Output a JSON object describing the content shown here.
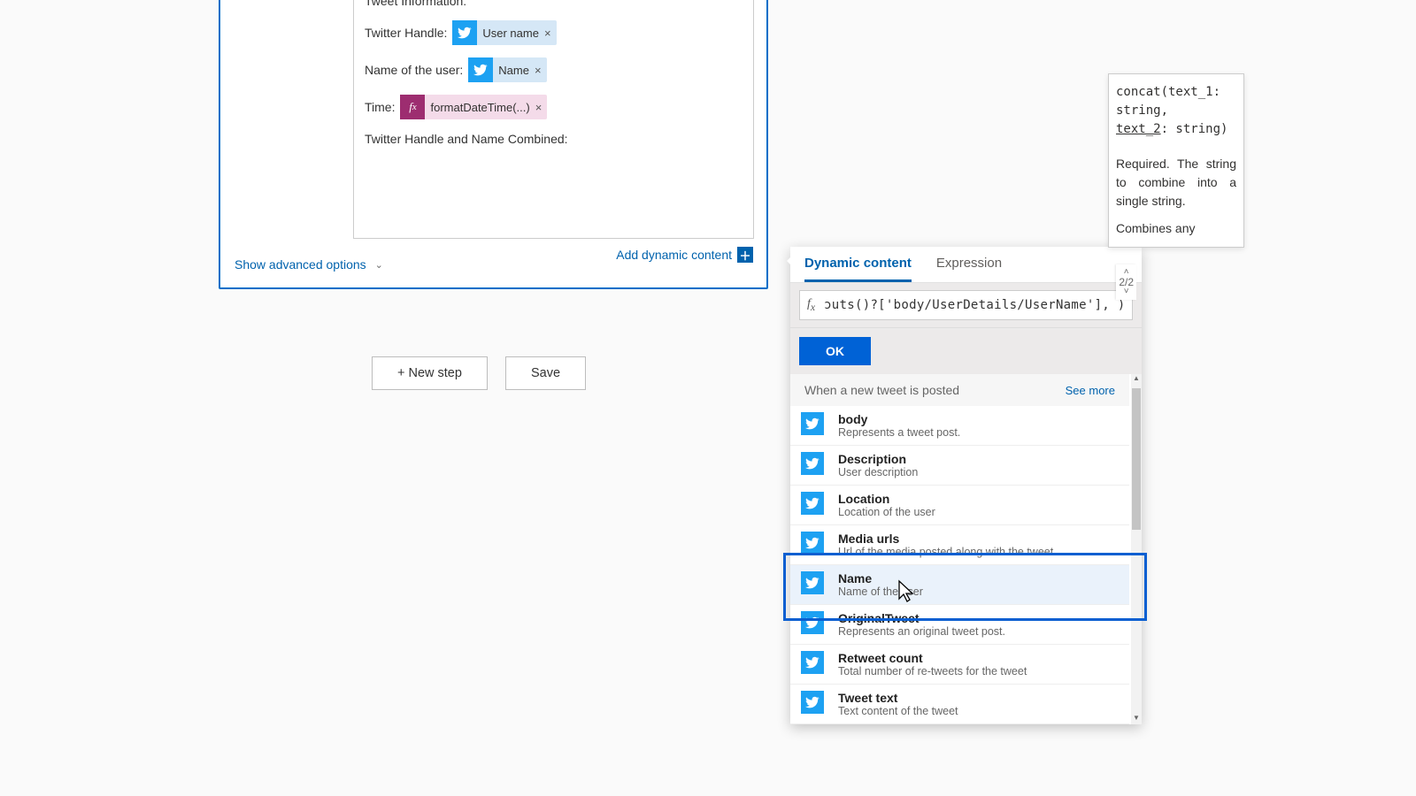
{
  "card": {
    "header_line": "Tweet Information:",
    "rows": {
      "handle_label": "Twitter Handle:",
      "handle_token": "User name",
      "name_label": "Name of the user:",
      "name_token": "Name",
      "time_label": "Time:",
      "time_token": "formatDateTime(...)",
      "combined_label": "Twitter Handle and Name Combined:"
    },
    "add_dynamic": "Add dynamic content",
    "show_advanced": "Show advanced options"
  },
  "buttons": {
    "new_step": "+ New step",
    "save": "Save"
  },
  "picker": {
    "tab_dynamic": "Dynamic content",
    "tab_expression": "Expression",
    "counter": "2/2",
    "expression_text": "ɔuts()?['body/UserDetails/UserName'], )",
    "ok": "OK",
    "group_title": "When a new tweet is posted",
    "see_more": "See more",
    "items": [
      {
        "title": "body",
        "desc": "Represents a tweet post."
      },
      {
        "title": "Description",
        "desc": "User description"
      },
      {
        "title": "Location",
        "desc": "Location of the user"
      },
      {
        "title": "Media urls",
        "desc": "Url of the media posted along with the tweet"
      },
      {
        "title": "Name",
        "desc": "Name of the user"
      },
      {
        "title": "OriginalTweet",
        "desc": "Represents an original tweet post."
      },
      {
        "title": "Retweet count",
        "desc": "Total number of re-tweets for the tweet"
      },
      {
        "title": "Tweet text",
        "desc": "Text content of the tweet"
      }
    ]
  },
  "tooltip": {
    "sig1": "concat(text_1: string,",
    "sig2_underlined": "text_2",
    "sig3": ": string)",
    "req": "Required. The string to combine into a single string.",
    "cut": "Combines any"
  }
}
